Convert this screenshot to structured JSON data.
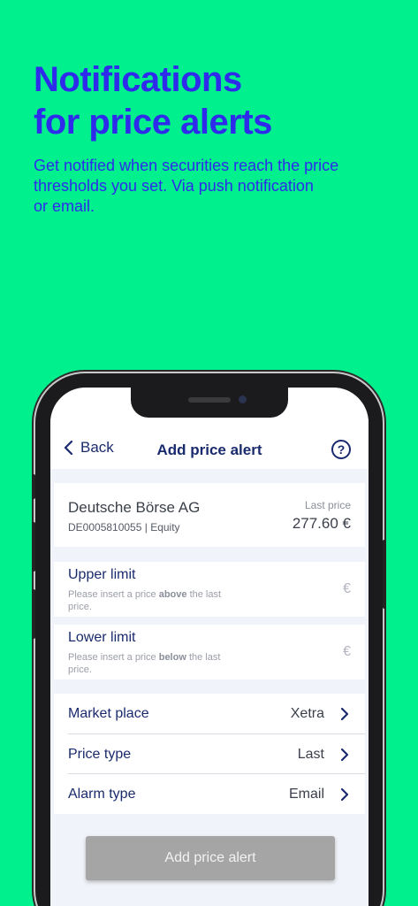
{
  "hero": {
    "title": "Notifications\nfor price alerts",
    "subtitle": "Get notified when securities reach the price\nthresholds you set. Via push notification\nor email."
  },
  "nav": {
    "back_label": "Back",
    "title": "Add price alert",
    "help_glyph": "?"
  },
  "security": {
    "name": "Deutsche Börse AG",
    "isin_type": "DE0005810055 | Equity",
    "last_price_label": "Last price",
    "last_price_value": "277.60 €"
  },
  "upper_limit": {
    "label": "Upper limit",
    "hint_prefix": "Please insert a price ",
    "hint_emph": "above",
    "hint_suffix": " the last price.",
    "currency": "€"
  },
  "lower_limit": {
    "label": "Lower limit",
    "hint_prefix": "Please insert a price ",
    "hint_emph": "below",
    "hint_suffix": " the last price.",
    "currency": "€"
  },
  "options": [
    {
      "label": "Market place",
      "value": "Xetra"
    },
    {
      "label": "Price type",
      "value": "Last"
    },
    {
      "label": "Alarm type",
      "value": "Email"
    }
  ],
  "submit_label": "Add price alert",
  "icons": {
    "back": "chevron-left-icon",
    "help": "question-circle-icon",
    "option_chevron": "chevron-right-icon"
  },
  "colors": {
    "background": "#00F08E",
    "hero_text": "#2E2BEA",
    "app_navy": "#1A2B6D",
    "button_disabled": "#A5A5A5"
  }
}
